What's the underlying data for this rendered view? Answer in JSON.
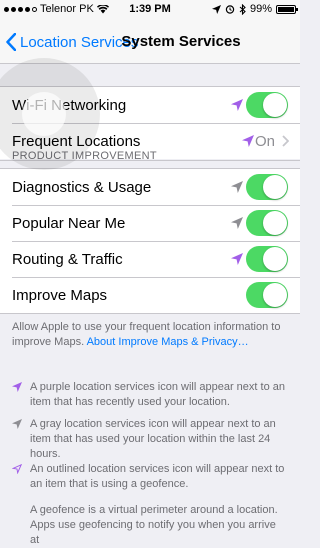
{
  "status_bar": {
    "carrier": "Telenor PK",
    "time": "1:39 PM",
    "battery": "99%",
    "battery_level": 0.99
  },
  "nav": {
    "back_label": "Location Services",
    "title": "System Services"
  },
  "top_rows": [
    {
      "label": "Wi-Fi Networking",
      "arrow_color": "#a25fe8",
      "switch_on": true
    },
    {
      "label": "Frequent Locations",
      "arrow_color": "#a25fe8",
      "value": "On"
    }
  ],
  "product_improvement": {
    "header": "PRODUCT IMPROVEMENT",
    "rows": [
      {
        "label": "Diagnostics & Usage",
        "arrow_color": "#8e8e93",
        "switch_on": true
      },
      {
        "label": "Popular Near Me",
        "arrow_color": "#8e8e93",
        "switch_on": true
      },
      {
        "label": "Routing & Traffic",
        "arrow_color": "#a25fe8",
        "switch_on": true
      },
      {
        "label": "Improve Maps",
        "switch_on": true
      }
    ],
    "footer_text": "Allow Apple to use your frequent location information to improve Maps.",
    "footer_link": "About Improve Maps & Privacy…"
  },
  "legend": [
    {
      "icon": "purple-location-arrow-icon",
      "color": "#a25fe8",
      "text": "A purple location services icon will appear next to an item that has recently used your location."
    },
    {
      "icon": "gray-location-arrow-icon",
      "color": "#8e8e93",
      "text": "A gray location services icon will appear next to an item that has used your location within the last 24 hours."
    },
    {
      "icon": "outlined-location-arrow-icon",
      "color": "#a25fe8",
      "text": "An outlined location services icon will appear next to an item that is using a geofence."
    }
  ],
  "geofence_text": "A geofence is a virtual perimeter around a location. Apps use geofencing to notify you when you arrive at",
  "colors": {
    "accent": "#007aff",
    "switch_on": "#4cd964",
    "purple": "#a25fe8",
    "gray": "#8e8e93"
  }
}
